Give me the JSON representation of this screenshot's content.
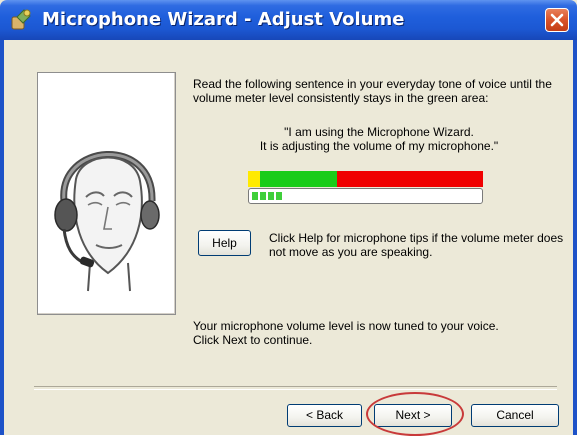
{
  "window": {
    "title": "Microphone Wizard - Adjust Volume",
    "icons": {
      "app": "microphone-wizard-icon",
      "close": "close-x-icon"
    }
  },
  "illustration": {
    "icon": "headset-head-icon"
  },
  "content": {
    "instruction": "Read the following sentence in your everyday tone of voice until the volume meter level consistently stays in the green area:",
    "quote_line1": "\"I am using the Microphone Wizard.",
    "quote_line2": "It is adjusting the volume of my microphone.\"",
    "help_label": "Help",
    "help_tip": "Click Help for microphone tips if the volume meter does not move as you are speaking.",
    "status_line1": "Your microphone volume level is now tuned to your voice.",
    "status_line2": "Click Next to continue."
  },
  "meter": {
    "level_blocks": 4,
    "colors": {
      "low": "#ffea00",
      "good": "#19cc19",
      "high": "#f00000",
      "level": "#3fcf3a"
    }
  },
  "footer": {
    "back_label": "< Back",
    "next_label": "Next >",
    "cancel_label": "Cancel",
    "highlight_color": "#c83a3a"
  }
}
